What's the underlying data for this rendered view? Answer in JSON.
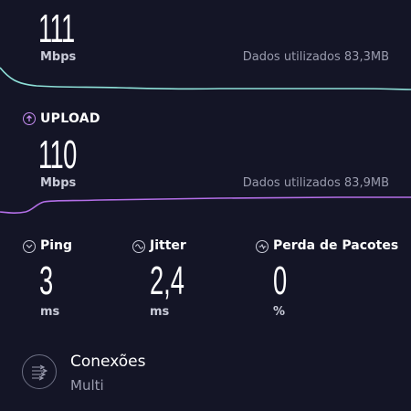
{
  "download": {
    "value": "111",
    "unit": "Mbps",
    "data_used": "Dados utilizados 83,3MB",
    "line_color": "#8ee0d8"
  },
  "upload": {
    "title": "UPLOAD",
    "value": "110",
    "unit": "Mbps",
    "data_used": "Dados utilizados 83,9MB",
    "line_color": "#b46fe8",
    "icon": "upload-arrow-icon"
  },
  "metrics": [
    {
      "label": "Ping",
      "value": "3",
      "unit": "ms",
      "icon": "ping-icon"
    },
    {
      "label": "Jitter",
      "value": "2,4",
      "unit": "ms",
      "icon": "jitter-icon"
    },
    {
      "label": "Perda de Pacotes",
      "value": "0",
      "unit": "%",
      "icon": "packet-loss-icon"
    }
  ],
  "connections": {
    "title": "Conexões",
    "mode": "Multi",
    "icon": "multi-connection-icon"
  }
}
